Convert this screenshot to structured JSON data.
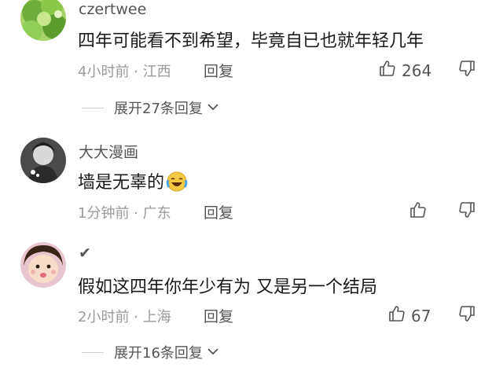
{
  "comments": [
    {
      "username": "czertwee",
      "content": "四年可能看不到希望，毕竟自已也就年轻几年",
      "meta": "4小时前 · 江西",
      "reply_label": "回复",
      "like_count": "264",
      "expand_label": "展开27条回复"
    },
    {
      "username": "大大漫画",
      "content": "墙是无辜的",
      "emoji": "crying-laughing-emoji",
      "meta": "1分钟前 · 广东",
      "reply_label": "回复",
      "like_count": ""
    },
    {
      "username": "✔",
      "content": "假如这四年你年少有为  又是另一个结局",
      "meta": "2小时前 · 上海",
      "reply_label": "回复",
      "like_count": "67",
      "expand_label": "展开16条回复"
    }
  ],
  "icons": {
    "like": "thumbs-up-icon",
    "dislike": "thumbs-down-icon",
    "expand": "chevron-down-icon"
  },
  "colors": {
    "text_primary": "#1a1a1a",
    "text_secondary": "#555555",
    "text_meta": "#9a9a9a",
    "emoji_yellow": "#f6c945"
  }
}
